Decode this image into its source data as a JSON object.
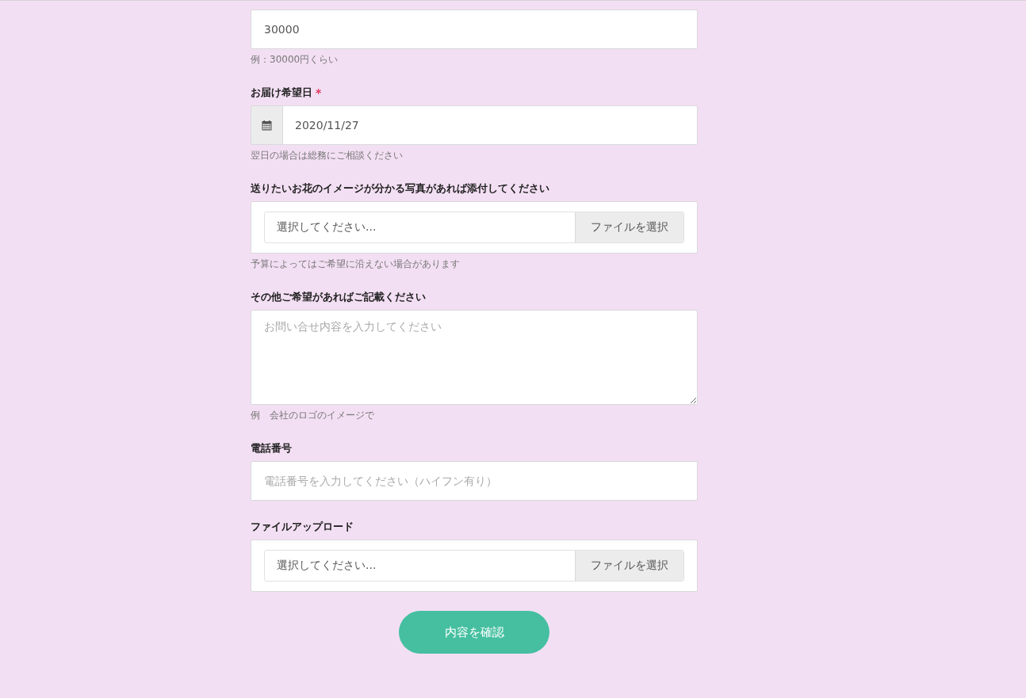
{
  "fields": [
    {
      "kind": "text",
      "value": "30000",
      "help": "例：30000円くらい"
    },
    {
      "kind": "date",
      "label": "お届け希望日",
      "required_mark": "*",
      "value": "2020/11/27",
      "help": "翌日の場合は総務にご相談ください"
    },
    {
      "kind": "file",
      "label": "送りたいお花のイメージが分かる写真があれば添付してください",
      "placeholder": "選択してください...",
      "button": "ファイルを選択",
      "help": "予算によってはご希望に沿えない場合があります"
    },
    {
      "kind": "textarea",
      "label": "その他ご希望があればご記載ください",
      "placeholder": "お問い合せ内容を入力してください",
      "help": "例　会社のロゴのイメージで"
    },
    {
      "kind": "tel",
      "label": "電話番号",
      "placeholder": "電話番号を入力してください（ハイフン有り）"
    },
    {
      "kind": "file",
      "label": "ファイルアップロード",
      "placeholder": "選択してください...",
      "button": "ファイルを選択"
    }
  ],
  "submit": "内容を確認"
}
